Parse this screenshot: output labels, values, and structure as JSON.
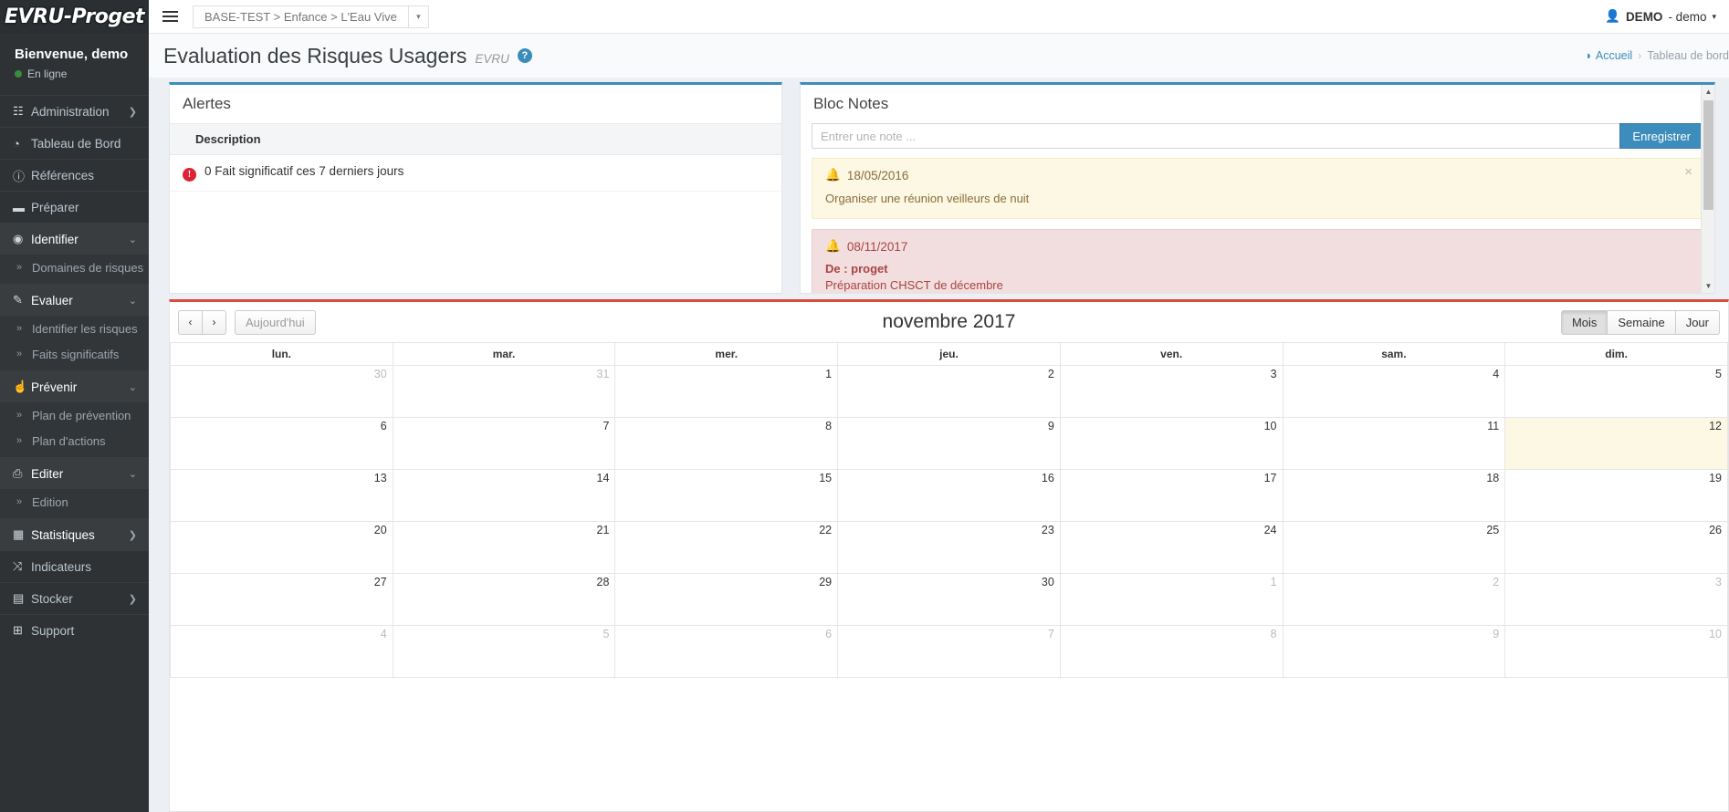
{
  "brand": {
    "logo_text": "EVRU-Proget"
  },
  "sidebar": {
    "welcome": "Bienvenue, demo",
    "status": "En ligne",
    "items": [
      {
        "label": "Administration",
        "icon": "building-icon",
        "glyph": "☷",
        "caret": "❯",
        "state": "plain"
      },
      {
        "label": "Tableau de Bord",
        "icon": "dashboard-icon",
        "glyph": "◔",
        "caret": "",
        "state": "plain"
      },
      {
        "label": "Références",
        "icon": "info-icon",
        "glyph": "ⓘ",
        "caret": "",
        "state": "plain"
      },
      {
        "label": "Préparer",
        "icon": "briefcase-icon",
        "glyph": "▬",
        "caret": "",
        "state": "plain"
      },
      {
        "label": "Identifier",
        "icon": "eye-icon",
        "glyph": "◉",
        "caret": "⌄",
        "state": "open",
        "children": [
          {
            "label": "Domaines de risques",
            "chev": "»"
          }
        ]
      },
      {
        "label": "Evaluer",
        "icon": "edit-icon",
        "glyph": "✎",
        "caret": "⌄",
        "state": "open",
        "children": [
          {
            "label": "Identifier les risques",
            "chev": "»"
          },
          {
            "label": "Faits significatifs",
            "chev": "»"
          }
        ]
      },
      {
        "label": "Prévenir",
        "icon": "thumbs-up-icon",
        "glyph": "☝",
        "caret": "⌄",
        "state": "open",
        "children": [
          {
            "label": "Plan de prévention",
            "chev": "»"
          },
          {
            "label": "Plan d'actions",
            "chev": "»"
          }
        ]
      },
      {
        "label": "Editer",
        "icon": "printer-icon",
        "glyph": "⎙",
        "caret": "⌄",
        "state": "open",
        "children": [
          {
            "label": "Edition",
            "chev": "»"
          }
        ]
      },
      {
        "label": "Statistiques",
        "icon": "bar-chart-icon",
        "glyph": "▦",
        "caret": "❯",
        "state": "active-plain"
      },
      {
        "label": "Indicateurs",
        "icon": "shuffle-icon",
        "glyph": "⤨",
        "caret": "",
        "state": "plain"
      },
      {
        "label": "Stocker",
        "icon": "archive-icon",
        "glyph": "▤",
        "caret": "❯",
        "state": "plain"
      },
      {
        "label": "Support",
        "icon": "medkit-icon",
        "glyph": "⊞",
        "caret": "",
        "state": "plain"
      }
    ]
  },
  "topbar": {
    "hamburger_name": "menu-toggle",
    "context": "BASE-TEST > Enfance > L'Eau Vive",
    "context_caret": "▾",
    "user_icon": "👤",
    "user_name": "DEMO",
    "user_sub": "- demo",
    "user_caret": "▾"
  },
  "header": {
    "title": "Evaluation des Risques Usagers",
    "subtitle": "EVRU",
    "help": "?",
    "breadcrumb_home_icon": "dashboard-icon",
    "breadcrumb_home": "Accueil",
    "breadcrumb_sep": "›",
    "breadcrumb_current": "Tableau de bord"
  },
  "alertes": {
    "title": "Alertes",
    "columns": [
      "Description"
    ],
    "rows": [
      {
        "icon": "!",
        "description": "0 Fait significatif ces 7 derniers jours"
      }
    ]
  },
  "bloc_notes": {
    "title": "Bloc Notes",
    "input_placeholder": "Entrer une note ...",
    "input_value": "",
    "save_label": "Enregistrer",
    "notes": [
      {
        "type": "warn",
        "bell": "🔔",
        "date": "18/05/2016",
        "from": "",
        "text": "Organiser une réunion veilleurs de nuit",
        "close": "×"
      },
      {
        "type": "danger",
        "bell": "🔔",
        "date": "08/11/2017",
        "from": "De : proget",
        "text": "Préparation CHSCT de décembre",
        "close": ""
      }
    ]
  },
  "calendar": {
    "prev": "‹",
    "next": "›",
    "today_label": "Aujourd'hui",
    "title": "novembre 2017",
    "views": [
      {
        "label": "Mois",
        "active": true
      },
      {
        "label": "Semaine",
        "active": false
      },
      {
        "label": "Jour",
        "active": false
      }
    ],
    "day_headers": [
      "lun.",
      "mar.",
      "mer.",
      "jeu.",
      "ven.",
      "sam.",
      "dim."
    ],
    "weeks": [
      [
        {
          "d": "30",
          "o": true
        },
        {
          "d": "31",
          "o": true
        },
        {
          "d": "1"
        },
        {
          "d": "2"
        },
        {
          "d": "3"
        },
        {
          "d": "4"
        },
        {
          "d": "5"
        }
      ],
      [
        {
          "d": "6"
        },
        {
          "d": "7"
        },
        {
          "d": "8"
        },
        {
          "d": "9"
        },
        {
          "d": "10"
        },
        {
          "d": "11"
        },
        {
          "d": "12",
          "today": true
        }
      ],
      [
        {
          "d": "13"
        },
        {
          "d": "14"
        },
        {
          "d": "15"
        },
        {
          "d": "16"
        },
        {
          "d": "17"
        },
        {
          "d": "18"
        },
        {
          "d": "19"
        }
      ],
      [
        {
          "d": "20"
        },
        {
          "d": "21"
        },
        {
          "d": "22"
        },
        {
          "d": "23"
        },
        {
          "d": "24"
        },
        {
          "d": "25"
        },
        {
          "d": "26"
        }
      ],
      [
        {
          "d": "27"
        },
        {
          "d": "28"
        },
        {
          "d": "29"
        },
        {
          "d": "30"
        },
        {
          "d": "1",
          "o": true
        },
        {
          "d": "2",
          "o": true
        },
        {
          "d": "3",
          "o": true
        }
      ],
      [
        {
          "d": "4",
          "o": true
        },
        {
          "d": "5",
          "o": true
        },
        {
          "d": "6",
          "o": true
        },
        {
          "d": "7",
          "o": true
        },
        {
          "d": "8",
          "o": true
        },
        {
          "d": "9",
          "o": true
        },
        {
          "d": "10",
          "o": true
        }
      ]
    ]
  },
  "colors": {
    "sidebar_bg": "#2f3235",
    "panel_accent": "#3c8dbc",
    "calendar_accent": "#dd4b39",
    "alert_red": "#dd2233",
    "online_green": "#3c8a40",
    "today_bg": "#fcf8e3"
  }
}
